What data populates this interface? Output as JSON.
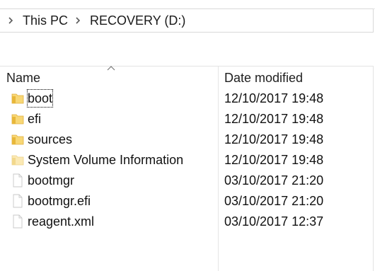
{
  "breadcrumb": {
    "items": [
      {
        "label": "This PC"
      },
      {
        "label": "RECOVERY (D:)"
      }
    ]
  },
  "columns": {
    "name": "Name",
    "date_modified": "Date modified"
  },
  "files": [
    {
      "name": "boot",
      "date": "12/10/2017 19:48",
      "kind": "folder"
    },
    {
      "name": "efi",
      "date": "12/10/2017 19:48",
      "kind": "folder"
    },
    {
      "name": "sources",
      "date": "12/10/2017 19:48",
      "kind": "folder"
    },
    {
      "name": "System Volume Information",
      "date": "12/10/2017 19:48",
      "kind": "folder-hidden"
    },
    {
      "name": "bootmgr",
      "date": "03/10/2017 21:20",
      "kind": "file"
    },
    {
      "name": "bootmgr.efi",
      "date": "03/10/2017 21:20",
      "kind": "file"
    },
    {
      "name": "reagent.xml",
      "date": "03/10/2017 12:37",
      "kind": "file"
    }
  ],
  "colors": {
    "folder": "#f8d775",
    "folder_dark": "#e8b73a",
    "folder_hidden": "#fbe9b4",
    "file_border": "#c8c8c8"
  }
}
